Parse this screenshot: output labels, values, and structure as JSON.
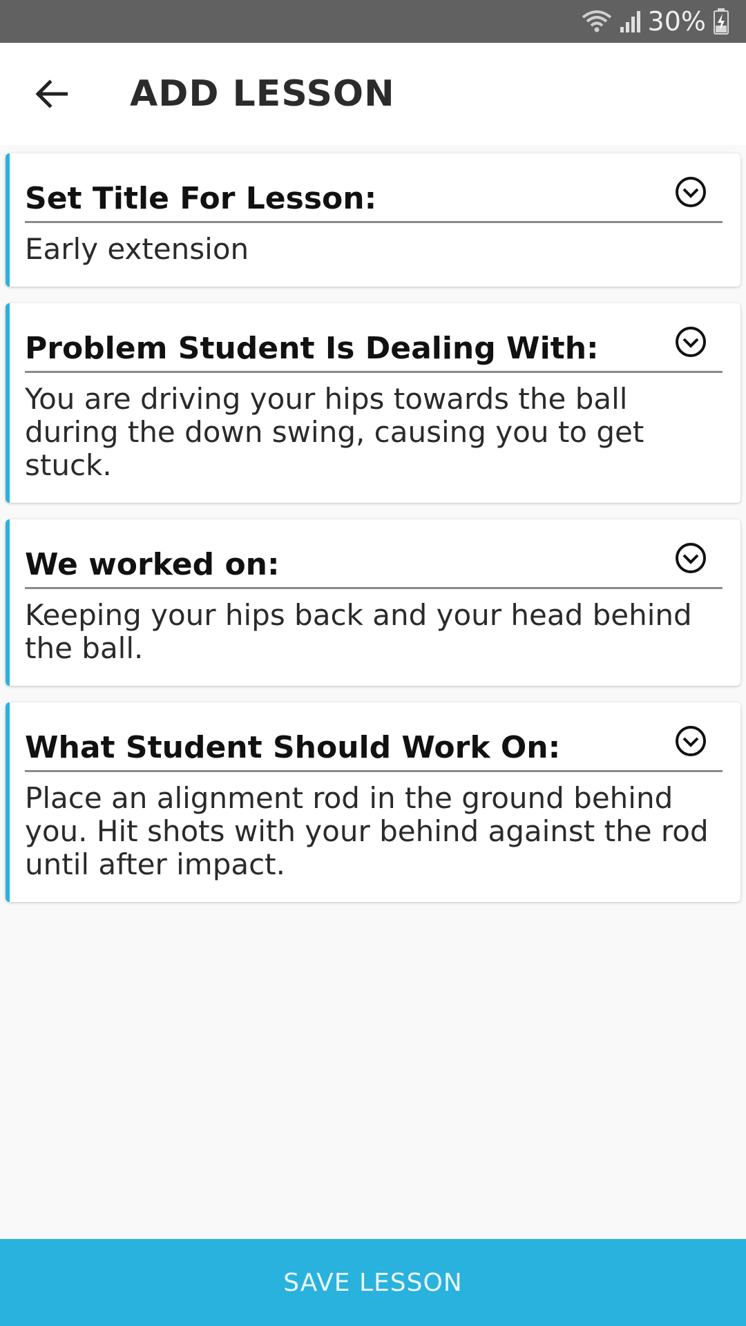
{
  "status_bar": {
    "battery_percent": "30%",
    "icons": [
      "wifi-icon",
      "signal-icon",
      "battery-charging-icon"
    ]
  },
  "app_bar": {
    "back_icon": "arrow-left-icon",
    "title": "ADD LESSON"
  },
  "cards": [
    {
      "heading": "Set Title For Lesson:",
      "value": "Early extension",
      "icon": "chevron-down-circle-icon"
    },
    {
      "heading": "Problem Student Is Dealing With:",
      "value": "You are driving your hips towards the ball during the down swing, causing you to get stuck.",
      "icon": "chevron-down-circle-icon"
    },
    {
      "heading": "We worked on:",
      "value": "Keeping your hips back and your head behind the ball.",
      "icon": "chevron-down-circle-icon"
    },
    {
      "heading": "What Student Should Work On:",
      "value": "Place an alignment rod in the ground behind you. Hit shots with your behind against the rod until after impact.",
      "icon": "chevron-down-circle-icon"
    }
  ],
  "footer": {
    "save_label": "SAVE LESSON"
  },
  "colors": {
    "accent": "#29b2dd",
    "status_bar": "#616161",
    "background": "#f9f9f9"
  }
}
